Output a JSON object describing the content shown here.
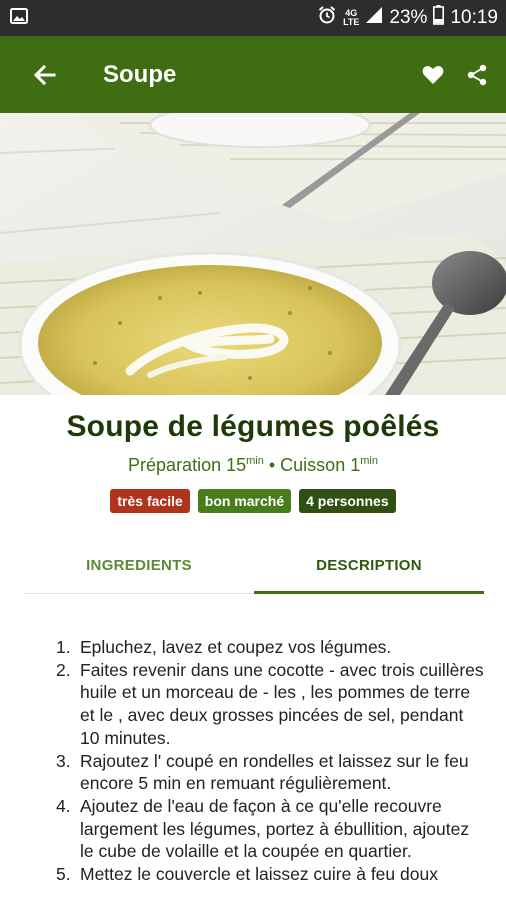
{
  "status_bar": {
    "network": "4G",
    "network_sub": "LTE",
    "battery": "23%",
    "time": "10:19",
    "icons": [
      "gallery-icon",
      "alarm-icon",
      "signal-icon",
      "battery-icon"
    ]
  },
  "app_bar": {
    "title": "Soupe",
    "icons": [
      "back-arrow-icon",
      "heart-icon",
      "share-icon"
    ],
    "color": "#3f6e12"
  },
  "recipe": {
    "title": "Soupe de légumes poêlés",
    "prep_label": "Préparation 15",
    "prep_unit": "min",
    "separator": " • ",
    "cook_label": "Cuisson 1",
    "cook_unit": "min",
    "badges": [
      {
        "label": "très facile",
        "color": "#b0331b"
      },
      {
        "label": "bon marché",
        "color": "#477d1a"
      },
      {
        "label": "4 personnes",
        "color": "#2f4f13"
      }
    ]
  },
  "tabs": [
    {
      "label": "INGREDIENTS",
      "active": false
    },
    {
      "label": "DESCRIPTION",
      "active": true
    }
  ],
  "steps": [
    {
      "num": "1.",
      "text": "Epluchez, lavez et coupez vos légumes."
    },
    {
      "num": "2.",
      "text": "Faites revenir dans une cocotte - avec trois cuillères huile et un morceau de - les , les pommes de terre et le , avec deux grosses pincées de sel, pendant 10 minutes."
    },
    {
      "num": "3.",
      "text": "Rajoutez l' coupé en rondelles et laissez sur le feu encore 5 min en remuant régulièrement."
    },
    {
      "num": "4.",
      "text": "Ajoutez de l'eau de façon à ce qu'elle recouvre largement les légumes, portez à ébullition, ajoutez le cube de volaille et la coupée en quartier."
    },
    {
      "num": "5.",
      "text": "Mettez le couvercle et laissez cuire à feu doux"
    }
  ]
}
